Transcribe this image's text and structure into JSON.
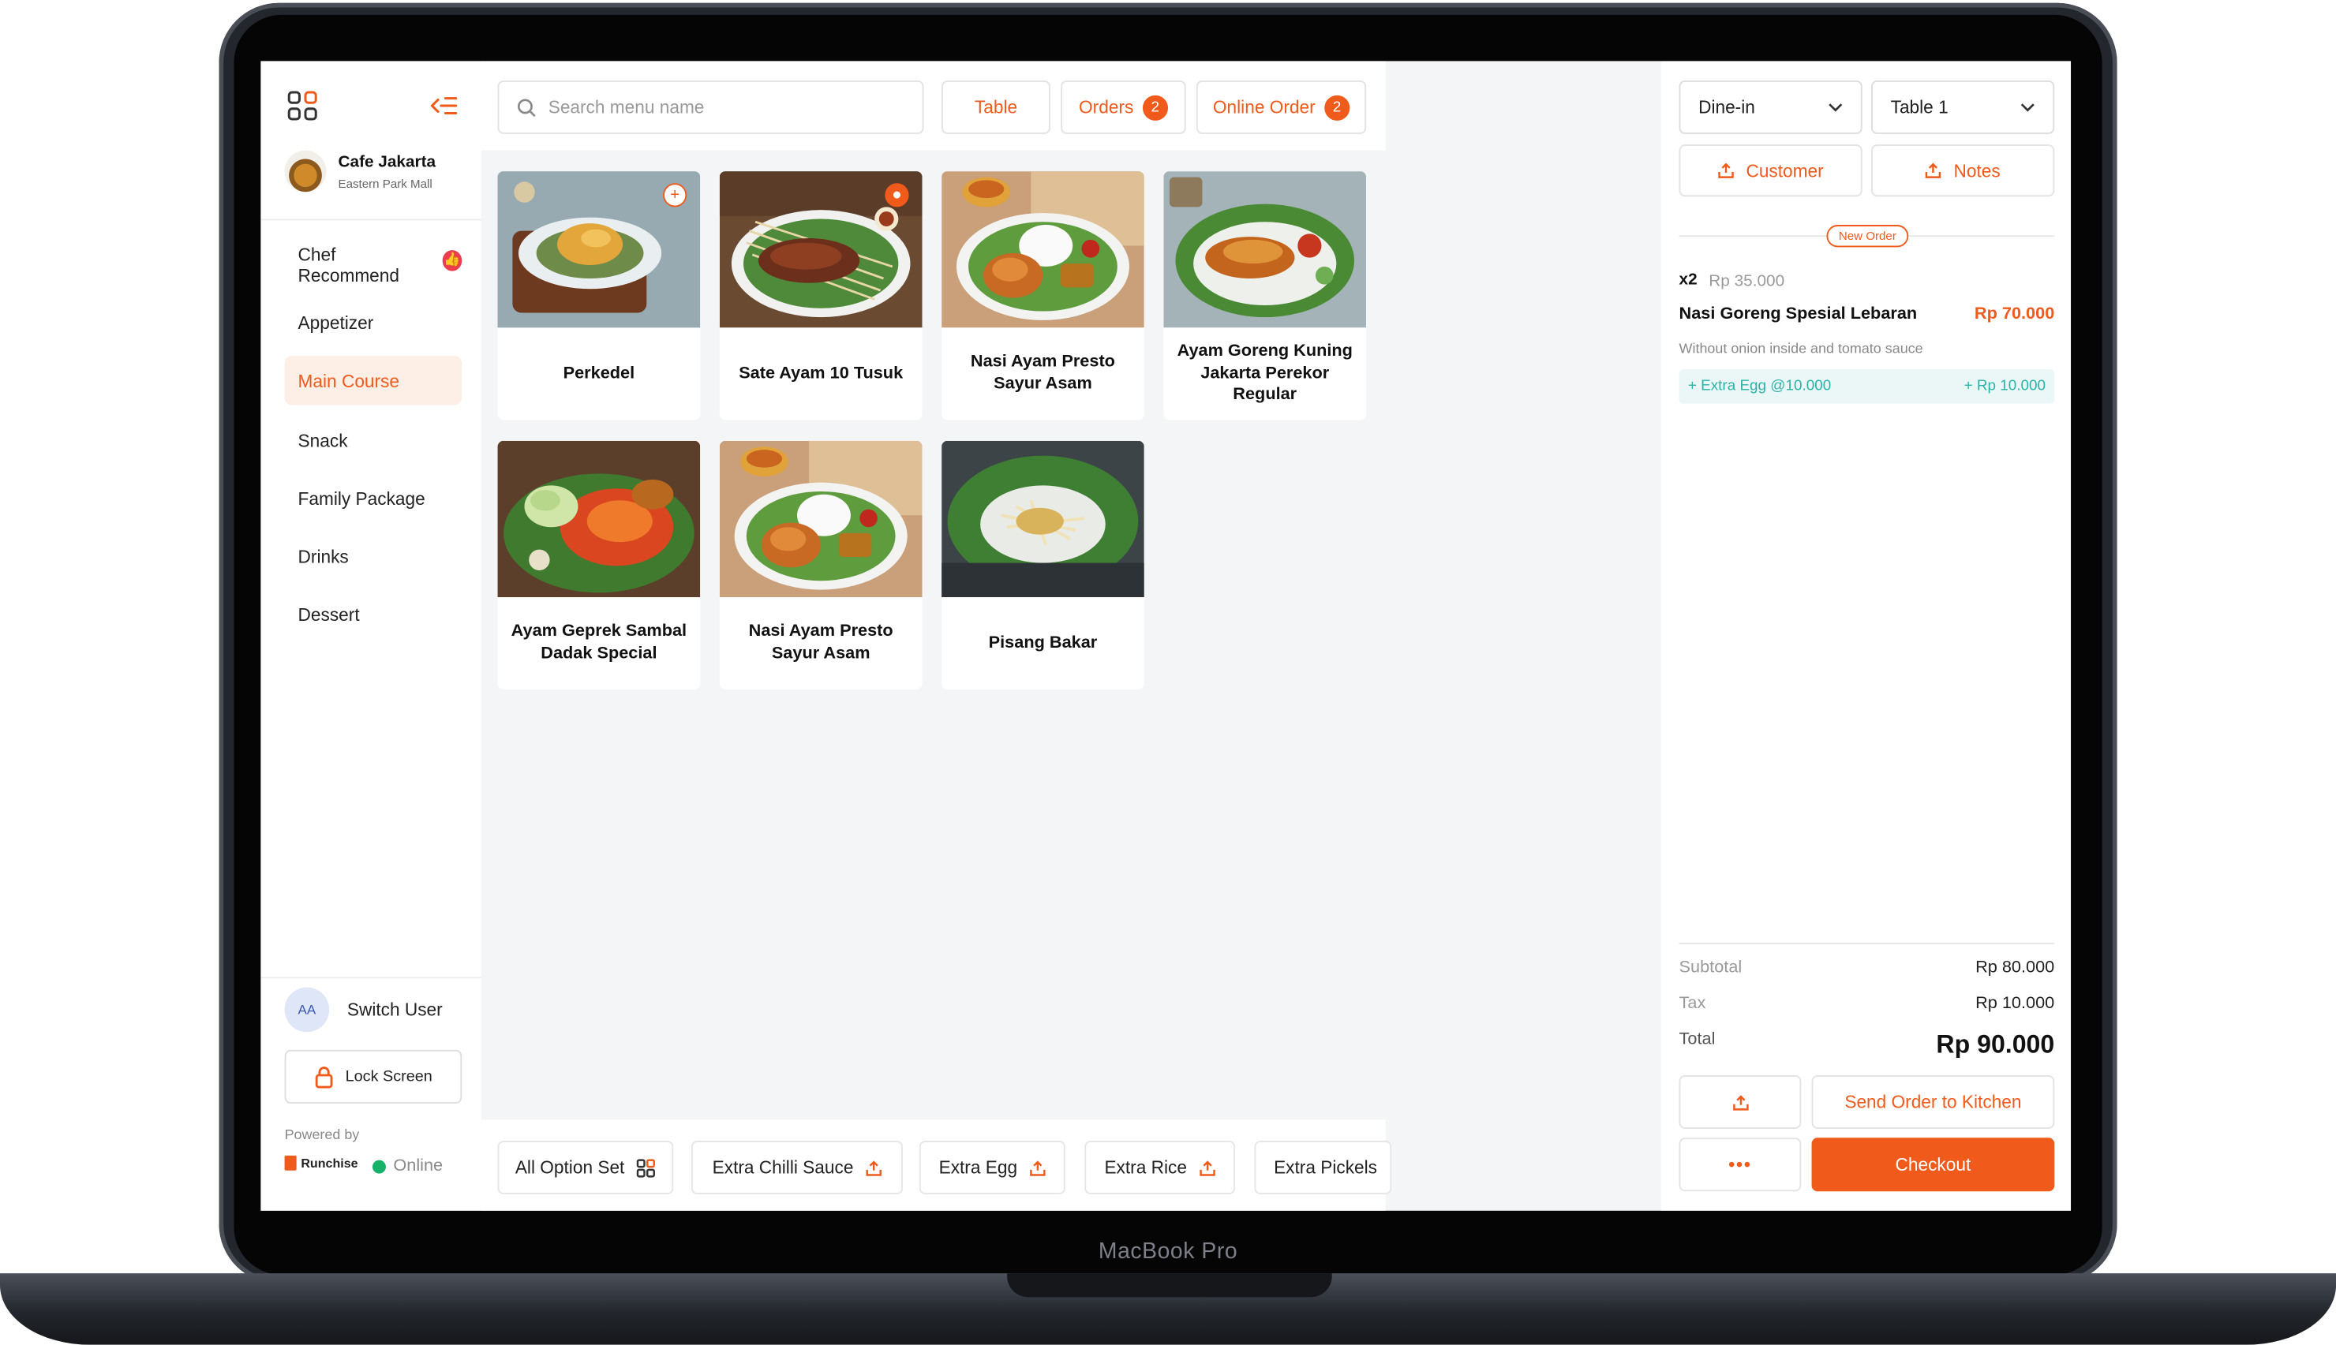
{
  "device": {
    "label": "MacBook Pro"
  },
  "colors": {
    "accent": "#f05a1a",
    "online": "#17b26a",
    "extra": "#2bb3a8",
    "badge_red": "#ec3d4f"
  },
  "sidebar": {
    "store_name": "Cafe Jakarta",
    "store_location": "Eastern Park Mall",
    "categories": [
      {
        "label": "Chef Recommend",
        "badge_icon": "thumbs-up-icon"
      },
      {
        "label": "Appetizer"
      },
      {
        "label": "Main Course",
        "active": true
      },
      {
        "label": "Snack"
      },
      {
        "label": "Family Package"
      },
      {
        "label": "Drinks"
      },
      {
        "label": "Dessert"
      }
    ],
    "user_initials": "AA",
    "switch_user": "Switch User",
    "lock_screen": "Lock Screen",
    "powered_by": "Powered by",
    "brand": "Runchise",
    "status": "Online"
  },
  "topbar": {
    "search_placeholder": "Search menu name",
    "table": "Table",
    "orders": "Orders",
    "orders_count": "2",
    "online_order": "Online Order",
    "online_order_count": "2"
  },
  "products": [
    {
      "name": "Perkedel",
      "icon": "plus-icon"
    },
    {
      "name": "Sate Ayam 10 Tusuk",
      "icon": "combo-icon"
    },
    {
      "name": "Nasi Ayam Presto Sayur Asam"
    },
    {
      "name": "Ayam Goreng Kuning Jakarta Perekor Regular"
    },
    {
      "name": "Ayam Geprek Sambal Dadak Special"
    },
    {
      "name": "Nasi Ayam Presto Sayur Asam"
    },
    {
      "name": "Pisang Bakar"
    }
  ],
  "options": [
    "All Option Set",
    "Extra Chilli Sauce",
    "Extra Egg",
    "Extra Rice",
    "Extra Pickels"
  ],
  "order": {
    "type": "Dine-in",
    "table": "Table 1",
    "customer": "Customer",
    "notes": "Notes",
    "new_order_tag": "New Order",
    "item": {
      "qty": "x2",
      "unit_price": "Rp 35.000",
      "name": "Nasi Goreng Spesial Lebaran",
      "total": "Rp 70.000",
      "note": "Without onion inside and tomato sauce",
      "extra_label": "+ Extra Egg @10.000",
      "extra_price": "+ Rp 10.000"
    },
    "subtotal_label": "Subtotal",
    "subtotal": "Rp 80.000",
    "tax_label": "Tax",
    "tax": "Rp 10.000",
    "total_label": "Total",
    "total": "Rp 90.000",
    "send_kitchen": "Send Order to Kitchen",
    "more": "•••",
    "checkout": "Checkout"
  }
}
